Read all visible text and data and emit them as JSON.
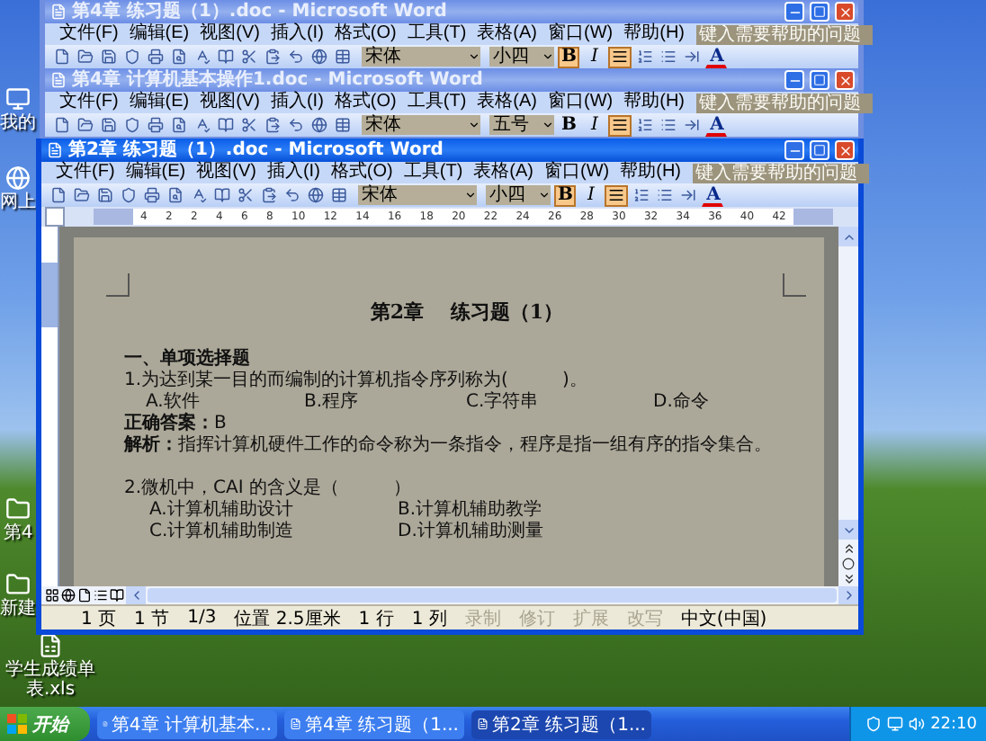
{
  "desktop_icons": [
    {
      "label": "我的"
    },
    {
      "label": "网上"
    },
    {
      "label": "第4"
    },
    {
      "label": "新建"
    },
    {
      "label": "学生成绩单表.xls"
    }
  ],
  "windows": [
    {
      "title": "第4章 练习题（1）.doc - Microsoft Word",
      "active": false,
      "menu": [
        "文件(F)",
        "编辑(E)",
        "视图(V)",
        "插入(I)",
        "格式(O)",
        "工具(T)",
        "表格(A)",
        "窗口(W)",
        "帮助(H)"
      ],
      "help_placeholder": "键入需要帮助的问题",
      "font": "宋体",
      "size": "小四",
      "bold_label": "B",
      "bold_on": true,
      "italic_label": "I",
      "justify_on": true,
      "font_color_label": "A"
    },
    {
      "title": "第4章 计算机基本操作1.doc - Microsoft Word",
      "active": false,
      "menu": [
        "文件(F)",
        "编辑(E)",
        "视图(V)",
        "插入(I)",
        "格式(O)",
        "工具(T)",
        "表格(A)",
        "窗口(W)",
        "帮助(H)"
      ],
      "help_placeholder": "键入需要帮助的问题",
      "font": "宋体",
      "size": "五号",
      "bold_label": "B",
      "bold_on": false,
      "italic_label": "I",
      "justify_on": true,
      "font_color_label": "A"
    },
    {
      "title": "第2章 练习题（1）.doc - Microsoft Word",
      "active": true,
      "menu": [
        "文件(F)",
        "编辑(E)",
        "视图(V)",
        "插入(I)",
        "格式(O)",
        "工具(T)",
        "表格(A)",
        "窗口(W)",
        "帮助(H)"
      ],
      "help_placeholder": "键入需要帮助的问题",
      "font": "宋体",
      "size": "小四",
      "bold_label": "B",
      "bold_on": true,
      "italic_label": "I",
      "justify_on": true,
      "font_color_label": "A"
    }
  ],
  "ruler_marks": [
    "4",
    "2",
    "2",
    "4",
    "6",
    "8",
    "10",
    "12",
    "14",
    "16",
    "18",
    "20",
    "22",
    "24",
    "26",
    "28",
    "30",
    "32",
    "34",
    "36",
    "40",
    "42"
  ],
  "document": [
    {
      "kind": "title",
      "text": "第2章　 练习题（1）"
    },
    {
      "kind": "blank"
    },
    {
      "kind": "heading",
      "text": "一、单项选择题"
    },
    {
      "kind": "question",
      "text": "1.为达到某一目的而编制的计算机指令序列称为(　　　)。"
    },
    {
      "kind": "options",
      "items": [
        "A.软件",
        "B.程序",
        "C.字符串",
        "D.命令"
      ]
    },
    {
      "kind": "answer",
      "text": "**正确答案：**B"
    },
    {
      "kind": "analysis",
      "text": "**解析：**指挥计算机硬件工作的命令称为一条指令，程序是指一组有序的指令集合。"
    },
    {
      "kind": "blank"
    },
    {
      "kind": "question",
      "text": "2.微机中，CAI 的含义是（　　　）"
    },
    {
      "kind": "options2",
      "items": [
        "A.计算机辅助设计",
        "B.计算机辅助教学"
      ]
    },
    {
      "kind": "options2",
      "items": [
        "C.计算机辅助制造",
        "D.计算机辅助测量"
      ]
    }
  ],
  "status_bar": [
    {
      "text": "1 页",
      "disabled": false
    },
    {
      "text": "1 节",
      "disabled": false
    },
    {
      "text": "1/3",
      "disabled": false
    },
    {
      "text": "位置 2.5厘米",
      "disabled": false
    },
    {
      "text": "1 行",
      "disabled": false
    },
    {
      "text": "1 列",
      "disabled": false
    },
    {
      "text": "录制",
      "disabled": true
    },
    {
      "text": "修订",
      "disabled": true
    },
    {
      "text": "扩展",
      "disabled": true
    },
    {
      "text": "改写",
      "disabled": true
    },
    {
      "text": "中文(中国)",
      "disabled": false
    }
  ],
  "taskbar": {
    "start": "开始",
    "tasks": [
      {
        "label": "第4章 计算机基本...",
        "selected": false
      },
      {
        "label": "第4章 练习题（1...",
        "selected": false
      },
      {
        "label": "第2章 练习题（1...",
        "selected": true
      }
    ],
    "clock": "22:10"
  }
}
